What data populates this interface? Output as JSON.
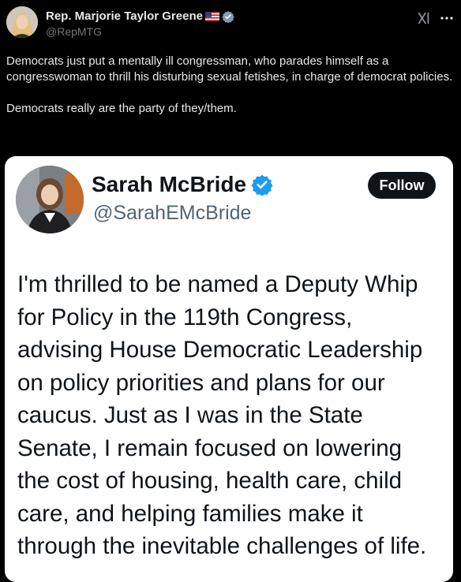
{
  "tweet": {
    "author": {
      "name": "Rep. Marjorie Taylor Greene",
      "handle": "@RepMTG",
      "avatar_icon": "profile-photo"
    },
    "text": "Democrats just put a mentally ill congressman, who parades himself as a congresswoman to thrill his disturbing sexual fetishes, in charge of democrat policies.\n\nDemocrats really are the party of they/them."
  },
  "embedded": {
    "author": {
      "name": "Sarah McBride",
      "handle": "@SarahEMcBride"
    },
    "follow_label": "Follow",
    "text_lines": [
      "I'm thrilled to be named a Deputy Whip",
      "for Policy in the 119th Congress,",
      "advising House Democratic Leadership",
      "on policy priorities and plans for our",
      "caucus. Just as I was in the State",
      "Senate, I remain focused on lowering",
      "the cost of housing, health care, child",
      "care, and helping families make it",
      "through the inevitable challenges of life."
    ]
  },
  "colors": {
    "background": "#000000",
    "text": "#e7e9ea",
    "secondary": "#71767b",
    "verified": "#1d9bf0",
    "embed_bg": "#ffffff",
    "follow_bg": "#0f1419"
  }
}
